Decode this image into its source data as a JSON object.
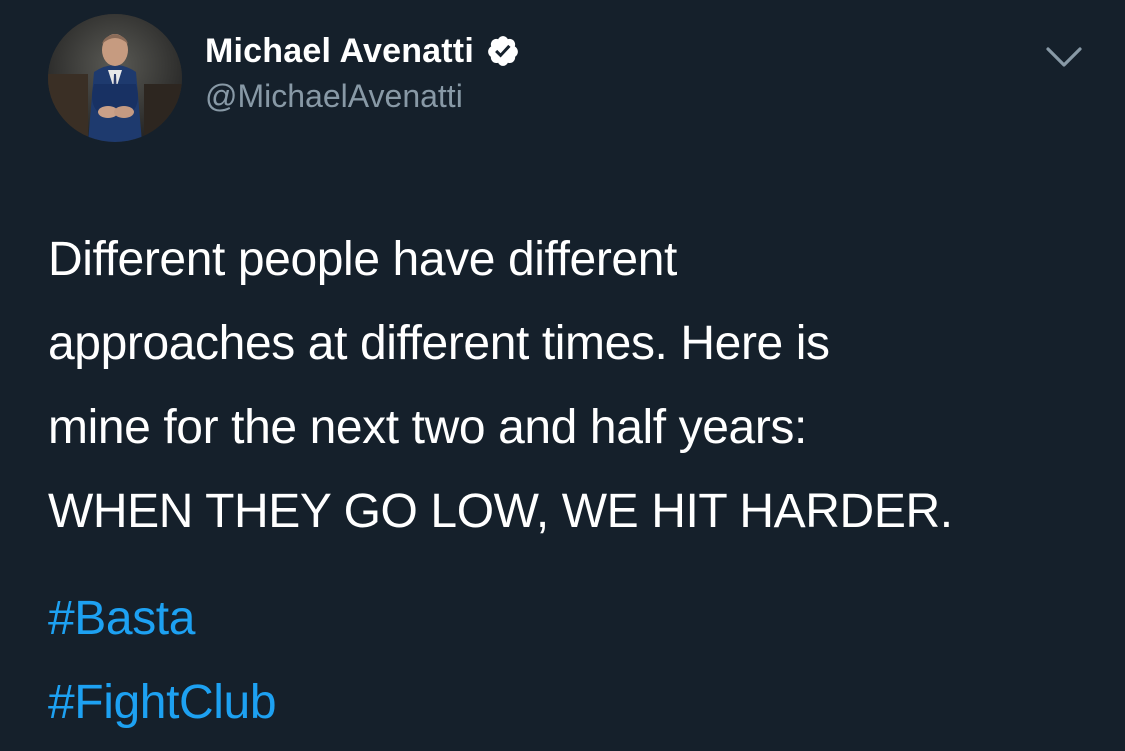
{
  "colors": {
    "background": "#15202b",
    "text": "#ffffff",
    "secondary": "#8899a6",
    "link": "#1da1f2"
  },
  "author": {
    "display_name": "Michael Avenatti",
    "handle": "@MichaelAvenatti",
    "verified": true,
    "verified_icon": "verified-badge-icon",
    "avatar": "profile-photo"
  },
  "menu_icon": "chevron-down-icon",
  "tweet": {
    "lines": [
      "Different people have different",
      "approaches at different times.  Here is",
      "mine for the next two and half years:",
      "WHEN THEY GO LOW, WE HIT HARDER."
    ],
    "hashtags": [
      "#Basta",
      "#FightClub"
    ]
  }
}
